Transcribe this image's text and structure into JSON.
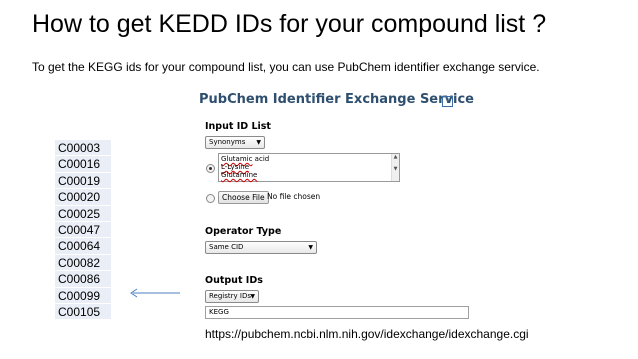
{
  "slide": {
    "title": "How to get KEDD IDs for your compound list ?",
    "subtitle": "To get the KEGG ids for your compound list, you can use PubChem identifier exchange service.",
    "url": "https://pubchem.ncbi.nlm.nih.gov/idexchange/idexchange.cgi"
  },
  "compound_ids": [
    "C00003",
    "C00016",
    "C00019",
    "C00020",
    "C00025",
    "C00047",
    "C00064",
    "C00082",
    "C00086",
    "C00099",
    "C00105"
  ],
  "service": {
    "title": "PubChem Identifier Exchange Service",
    "help_icon": "?",
    "input_section": {
      "label": "Input ID List",
      "type_select": "Synonyms",
      "textarea_lines": [
        {
          "word": "Glutamic",
          "rest": " acid"
        },
        {
          "word": "L-Lysine",
          "rest": ""
        },
        {
          "word": "Glutamine",
          "rest": ""
        }
      ],
      "file_button": "Choose File",
      "file_status": "No file chosen",
      "radio_selected": "textarea"
    },
    "operator_section": {
      "label": "Operator Type",
      "select": "Same CID"
    },
    "output_section": {
      "label": "Output IDs",
      "select": "Registry IDs",
      "value": "KEGG"
    }
  },
  "colors": {
    "id_list_bg": "#eaeef7",
    "service_title": "#2f4f6f",
    "arrow": "#4a7fc0"
  },
  "icons": {
    "dropdown": "caret-down-icon",
    "help": "help-icon",
    "arrow": "left-arrow-icon"
  }
}
